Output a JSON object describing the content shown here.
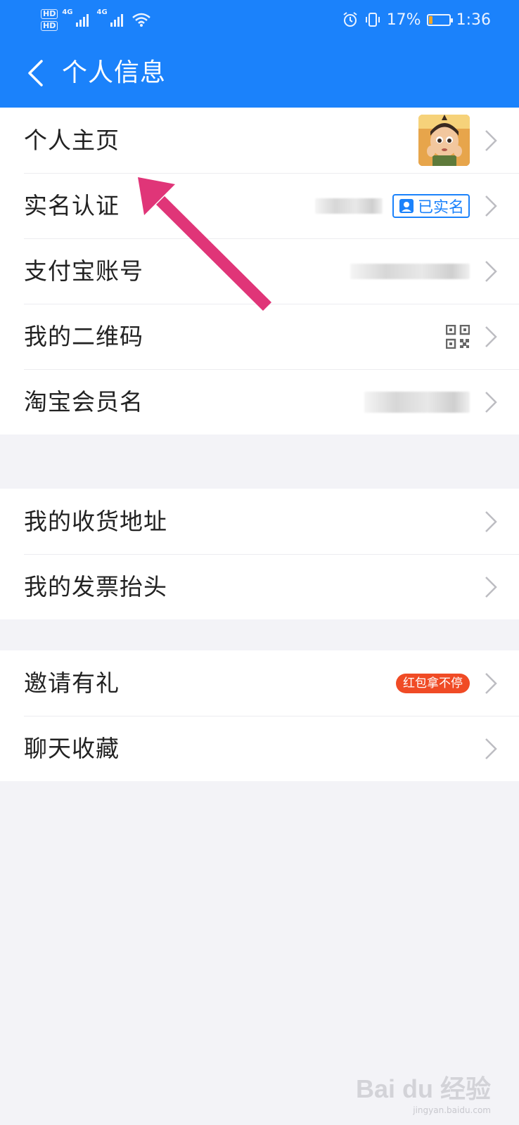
{
  "status_bar": {
    "hd1": "HD",
    "hd2": "HD",
    "net1": "4G",
    "net2": "4G",
    "battery_percent": "17%",
    "battery_level": 0.17,
    "time": "1:36",
    "icons": [
      "signal-icon",
      "wifi-icon",
      "alarm-icon",
      "vibrate-icon",
      "battery-icon"
    ]
  },
  "nav": {
    "title": "个人信息",
    "back_icon": "chevron-left-icon"
  },
  "groups": [
    {
      "items": [
        {
          "label": "个人主页",
          "trailing": "avatar"
        },
        {
          "label": "实名认证",
          "trailing": "verified",
          "badge": "已实名"
        },
        {
          "label": "支付宝账号",
          "trailing": "blurred"
        },
        {
          "label": "我的二维码",
          "trailing": "qr-code-icon"
        },
        {
          "label": "淘宝会员名",
          "trailing": "blurred"
        }
      ]
    },
    {
      "items": [
        {
          "label": "我的收货地址"
        },
        {
          "label": "我的发票抬头"
        }
      ]
    },
    {
      "items": [
        {
          "label": "邀请有礼",
          "trailing": "promo",
          "badge": "红包拿不停"
        },
        {
          "label": "聊天收藏"
        }
      ]
    }
  ],
  "watermark": {
    "logo": "Bai du 经验",
    "sub": "jingyan.baidu.com"
  },
  "colors": {
    "primary": "#1b82fb",
    "promo": "#f04b25",
    "annotation_arrow": "#e03578",
    "page_bg": "#f3f3f7"
  }
}
